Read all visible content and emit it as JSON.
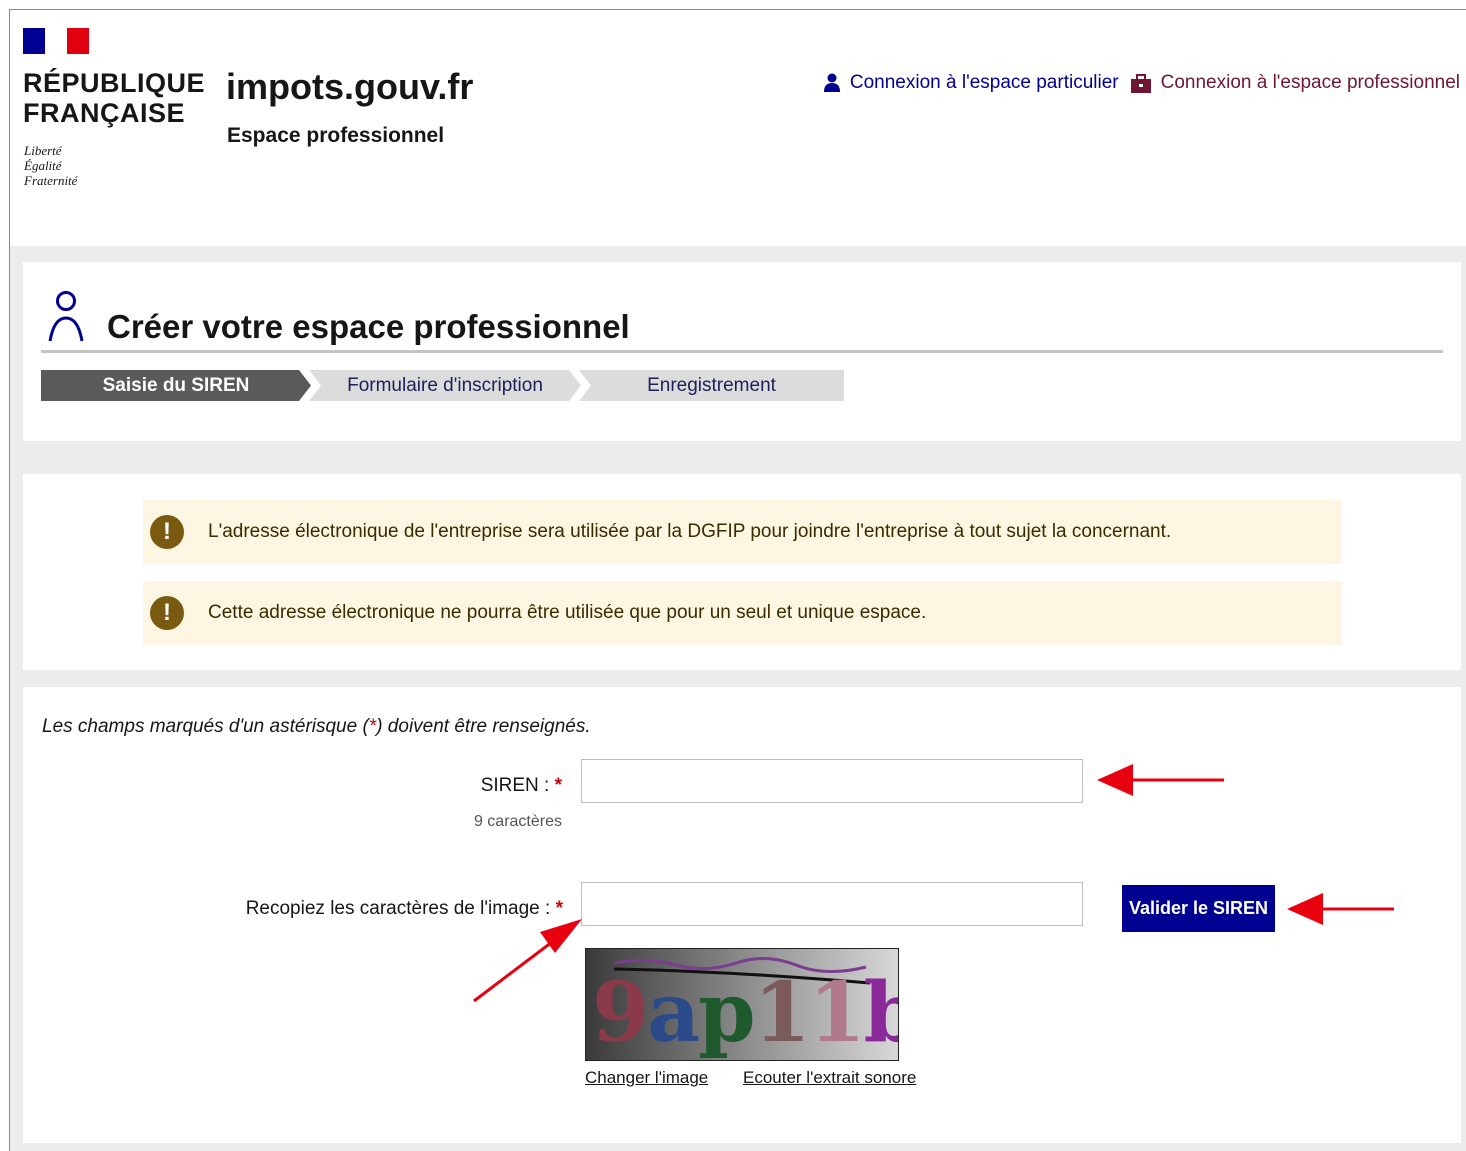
{
  "header": {
    "marianne_line1": "RÉPUBLIQUE",
    "marianne_line2": "FRANÇAISE",
    "devise1": "Liberté",
    "devise2": "Égalité",
    "devise3": "Fraternité",
    "site_title": "impots.gouv.fr",
    "site_subtitle": "Espace professionnel",
    "link_particulier": "Connexion à l'espace particulier",
    "link_professionnel": "Connexion à l'espace professionnel"
  },
  "page": {
    "title": "Créer votre espace professionnel",
    "steps": [
      "Saisie du SIREN",
      "Formulaire d'inscription",
      "Enregistrement"
    ]
  },
  "alerts": [
    "L'adresse électronique de l'entreprise sera utilisée par la DGFIP pour joindre l'entreprise à tout sujet la concernant.",
    "Cette adresse électronique ne pourra être utilisée que pour un seul et unique espace."
  ],
  "form": {
    "note_pre": "Les champs marqués d'un astérisque (",
    "note_star": "*",
    "note_post": ") doivent être renseignés.",
    "siren_label": "SIREN : ",
    "star": "*",
    "siren_hint": "9 caractères",
    "siren_value": "",
    "captcha_label": "Recopiez les caractères de l'image : ",
    "captcha_value": "",
    "submit_label": "Valider le SIREN",
    "captcha_text": [
      "9",
      "a",
      "p",
      "1",
      "1",
      "b"
    ],
    "change_image": "Changer l'image",
    "audio": "Ecouter l'extrait sonore"
  },
  "colors": {
    "primary": "#000091",
    "pro": "#6e1633",
    "alert_bg": "#fcf6e2",
    "annotation_arrow": "#e8000f"
  }
}
